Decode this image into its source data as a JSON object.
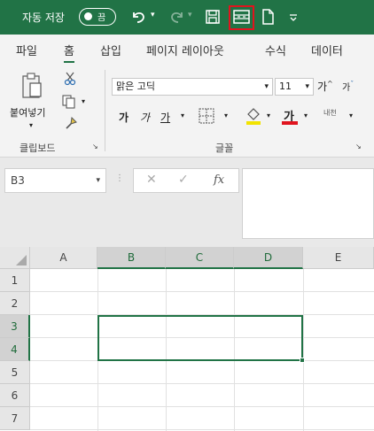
{
  "titlebar": {
    "autosave_label": "자동 저장",
    "toggle_label": "끔",
    "undo_icon": "undo-icon",
    "redo_icon": "redo-icon",
    "save_icon": "save-icon",
    "highlighted_icon": "merge-cells-icon",
    "new_icon": "new-document-icon",
    "more_icon": "customize-toolbar-icon",
    "accent_color": "#217346",
    "highlight_color": "#e0141e"
  },
  "tabs": [
    {
      "label": "파일"
    },
    {
      "label": "홈",
      "active": true
    },
    {
      "label": "삽입"
    },
    {
      "label": "페이지 레이아웃"
    },
    {
      "label": "수식"
    },
    {
      "label": "데이터"
    }
  ],
  "ribbon": {
    "clipboard": {
      "paste_label": "붙여넣기",
      "group_label": "클립보드"
    },
    "font": {
      "font_name": "맑은 고딕",
      "font_size": "11",
      "grow_label": "가",
      "shrink_label": "가",
      "bold_label": "가",
      "italic_label": "가",
      "underline_label": "가",
      "font_color_label": "가",
      "phonetic_label": "내천",
      "group_label": "글꼴"
    }
  },
  "formula_bar": {
    "namebox_value": "B3",
    "cancel_symbol": "✕",
    "enter_symbol": "✓",
    "fx_label": "fx",
    "formula_value": ""
  },
  "grid": {
    "columns": [
      "A",
      "B",
      "C",
      "D",
      "E"
    ],
    "rows": [
      "1",
      "2",
      "3",
      "4",
      "5",
      "6",
      "7"
    ],
    "selected_range": "B3:D4"
  }
}
